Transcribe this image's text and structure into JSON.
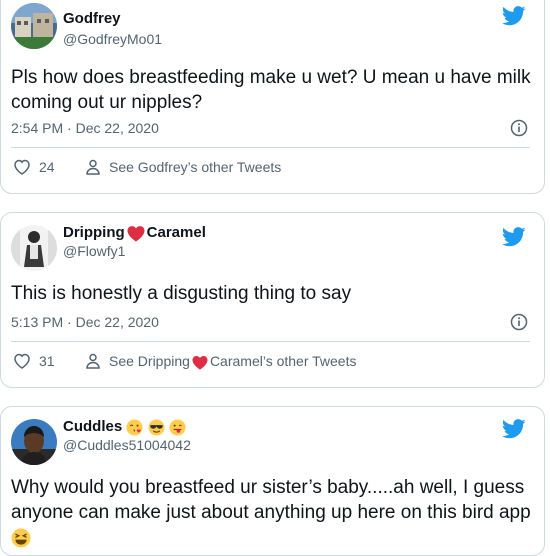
{
  "tweets": [
    {
      "name": "Godfrey",
      "handle": "@GodfreyMo01",
      "text": "Pls how does breastfeeding make u wet? U mean u have milk coming out ur nipples?",
      "timestamp": "2:54 PM · Dec 22, 2020",
      "likes": "24",
      "see_other": "See Godfrey’s other Tweets"
    },
    {
      "name_part1": "Dripping",
      "name_part2": "Caramel",
      "handle": "@Flowfy1",
      "text": "This is honestly a disgusting thing to say",
      "timestamp": "5:13 PM · Dec 22, 2020",
      "likes": "31",
      "see_other_prefix": "See Dripping",
      "see_other_suffix": "Caramel’s other Tweets"
    },
    {
      "name": "Cuddles",
      "handle": "@Cuddles51004042",
      "text": "Why would you breastfeed ur sister’s baby.....ah well, I guess anyone can make just about anything up here on this bird app"
    }
  ],
  "colors": {
    "twitter_blue": "#1d9bf0",
    "text_primary": "#0f1419",
    "text_secondary": "#536471",
    "border": "#cfd9de",
    "heart_red": "#e0245e"
  },
  "icons": {
    "bird": "twitter-bird-icon",
    "info": "info-icon",
    "heart": "heart-outline-icon",
    "person": "person-icon"
  }
}
